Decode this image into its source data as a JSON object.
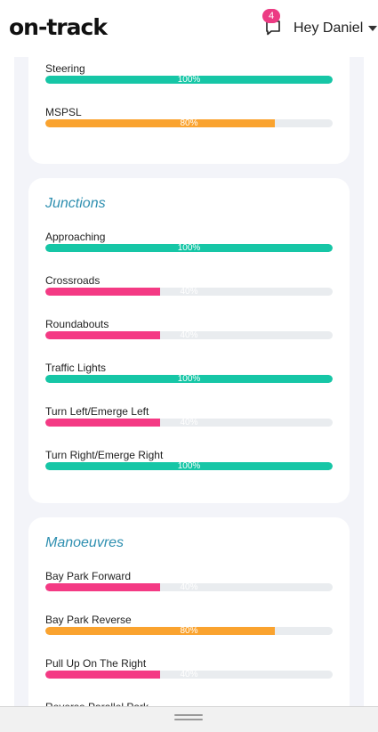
{
  "header": {
    "logo": "on-track",
    "notification_count": "4",
    "user_greeting": "Hey Daniel"
  },
  "colors": {
    "green": "#16c6a6",
    "pink": "#f43a84",
    "orange": "#faa32f",
    "track": "#e9ecef",
    "title": "#2e8fb0"
  },
  "sections": [
    {
      "title": "",
      "skills": [
        {
          "label": "Steering",
          "percent": 100,
          "color": "green",
          "text": "100%"
        },
        {
          "label": "MSPSL",
          "percent": 80,
          "color": "orange",
          "text": "80%"
        }
      ]
    },
    {
      "title": "Junctions",
      "skills": [
        {
          "label": "Approaching",
          "percent": 100,
          "color": "green",
          "text": "100%"
        },
        {
          "label": "Crossroads",
          "percent": 40,
          "color": "pink",
          "text": "40%"
        },
        {
          "label": "Roundabouts",
          "percent": 40,
          "color": "pink",
          "text": "40%"
        },
        {
          "label": "Traffic Lights",
          "percent": 100,
          "color": "green",
          "text": "100%"
        },
        {
          "label": "Turn Left/Emerge Left",
          "percent": 40,
          "color": "pink",
          "text": "40%"
        },
        {
          "label": "Turn Right/Emerge Right",
          "percent": 100,
          "color": "green",
          "text": "100%"
        }
      ]
    },
    {
      "title": "Manoeuvres",
      "skills": [
        {
          "label": "Bay Park Forward",
          "percent": 40,
          "color": "pink",
          "text": "40%"
        },
        {
          "label": "Bay Park Reverse",
          "percent": 80,
          "color": "orange",
          "text": "80%"
        },
        {
          "label": "Pull Up On The Right",
          "percent": 40,
          "color": "pink",
          "text": "40%"
        },
        {
          "label": "Reverse Parallel Park",
          "percent": 0,
          "color": "pink",
          "text": ""
        }
      ]
    }
  ]
}
